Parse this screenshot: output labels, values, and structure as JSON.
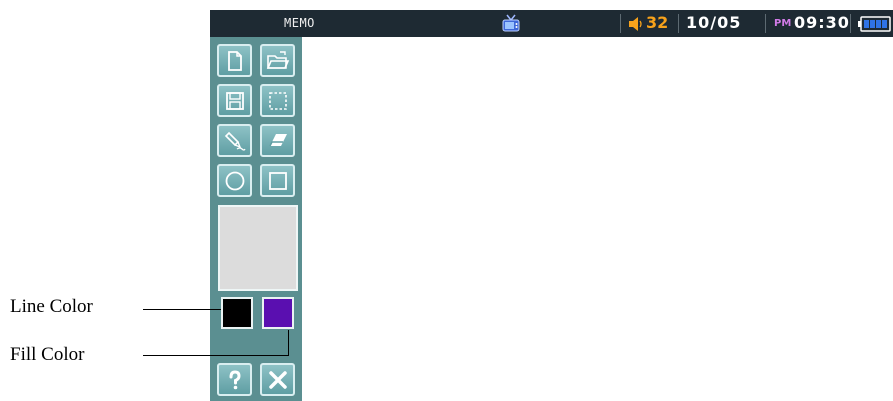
{
  "app": {
    "title": "MEMO"
  },
  "status": {
    "volume": "32",
    "date": "10/05",
    "ampm": "PM",
    "time": "09:30",
    "icons": [
      "tv-icon",
      "speaker-icon",
      "battery-icon"
    ],
    "volume_color": "#f7a21b",
    "ampm_color": "#d27be8"
  },
  "toolbar": {
    "buttons": [
      {
        "name": "new-document-button",
        "icon": "new-document-icon"
      },
      {
        "name": "open-folder-button",
        "icon": "open-folder-icon"
      },
      {
        "name": "save-button",
        "icon": "floppy-disk-icon"
      },
      {
        "name": "select-button",
        "icon": "dashed-rectangle-icon"
      },
      {
        "name": "pen-button",
        "icon": "pen-icon"
      },
      {
        "name": "eraser-button",
        "icon": "eraser-icon"
      },
      {
        "name": "circle-button",
        "icon": "circle-icon"
      },
      {
        "name": "rectangle-button",
        "icon": "rectangle-icon"
      },
      {
        "name": "help-button",
        "icon": "question-mark-icon"
      },
      {
        "name": "close-button",
        "icon": "close-icon"
      }
    ],
    "line_color": "#000000",
    "fill_color": "#5a0fb0"
  },
  "callouts": {
    "line_color_label": "Line Color",
    "fill_color_label": "Fill Color"
  }
}
